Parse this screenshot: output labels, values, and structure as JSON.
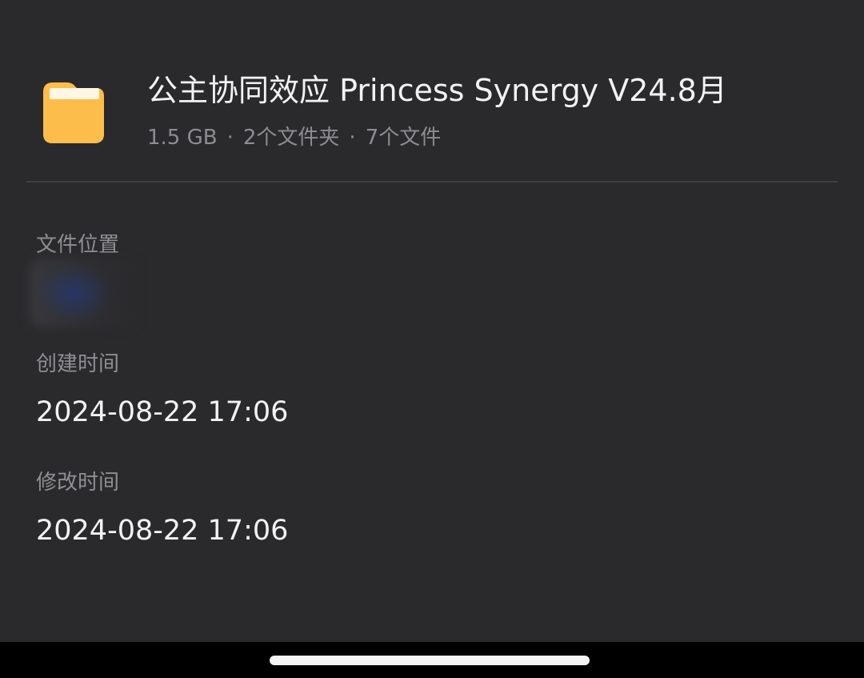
{
  "folder": {
    "name": "公主协同效应 Princess Synergy V24.8月",
    "size": "1.5 GB",
    "separator": "·",
    "folder_count": "2个文件夹",
    "file_count": "7个文件",
    "icon": "folder-icon",
    "icon_color": "#fdbd4a"
  },
  "details": {
    "location_label": "文件位置",
    "created_label": "创建时间",
    "created_value": "2024-08-22 17:06",
    "modified_label": "修改时间",
    "modified_value": "2024-08-22 17:06"
  },
  "colors": {
    "background": "#2a2a2c",
    "primary_text": "#f2f2f2",
    "secondary_text": "#8f8f93"
  }
}
